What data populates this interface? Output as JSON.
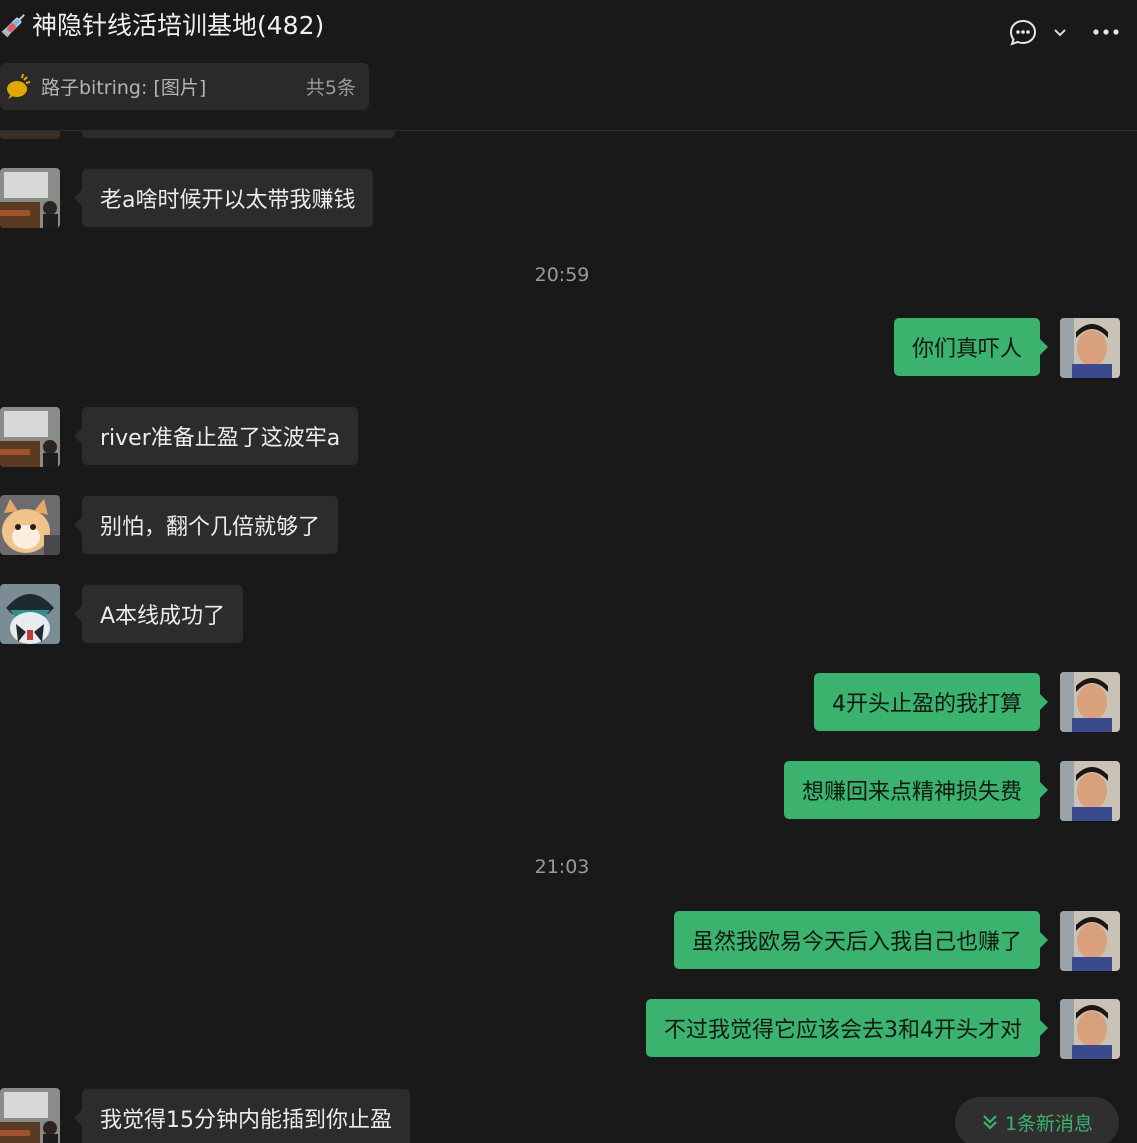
{
  "header": {
    "title": "神隐针线活培训基地(482)",
    "title_icon": "syringe-icon",
    "pinned": {
      "text": "路子bitring: [图片]",
      "count": "共5条"
    }
  },
  "messages": [
    {
      "side": "in",
      "avatar": "avatar-street",
      "text": "老a啥时候开以太带我赚钱"
    },
    {
      "type": "time",
      "text": "20:59"
    },
    {
      "side": "out",
      "avatar": "avatar-self",
      "text": "你们真吓人"
    },
    {
      "side": "in",
      "avatar": "avatar-street",
      "text": "river准备止盈了这波牢a"
    },
    {
      "side": "in",
      "avatar": "avatar-cat",
      "text": "别怕，翻个几倍就够了"
    },
    {
      "side": "in",
      "avatar": "avatar-cartoon",
      "text": "A本线成功了"
    },
    {
      "side": "out",
      "avatar": "avatar-self",
      "text": "4开头止盈的我打算"
    },
    {
      "side": "out",
      "avatar": "avatar-self",
      "text": "想赚回来点精神损失费"
    },
    {
      "type": "time",
      "text": "21:03"
    },
    {
      "side": "out",
      "avatar": "avatar-self",
      "text": "虽然我欧易今天后入我自己也赚了"
    },
    {
      "side": "out",
      "avatar": "avatar-self",
      "text": "不过我觉得它应该会去3和4开头才对"
    },
    {
      "side": "in",
      "avatar": "avatar-street",
      "text": "我觉得15分钟内能插到你止盈"
    }
  ],
  "new_messages_button": "1条新消息",
  "colors": {
    "background": "#191919",
    "bubble_in": "#2c2c2c",
    "bubble_out": "#3bb26e",
    "accent": "#3bb26e"
  }
}
